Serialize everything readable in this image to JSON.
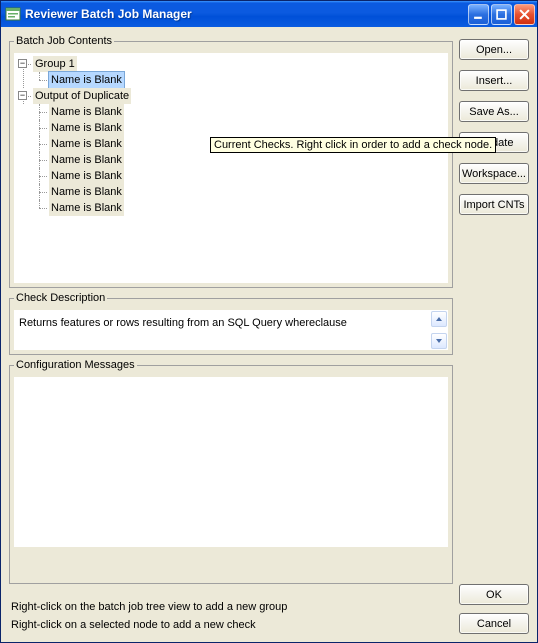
{
  "window": {
    "title": "Reviewer Batch Job Manager"
  },
  "tooltip": "Current Checks. Right click in order to add a check node.",
  "sections": {
    "contents": "Batch Job Contents",
    "description": "Check Description",
    "config": "Configuration Messages"
  },
  "tree": {
    "group1": "Group 1",
    "group1_children": [
      "Name is Blank"
    ],
    "output": "Output of Duplicate",
    "output_children": [
      "Name is Blank",
      "Name is Blank",
      "Name is Blank",
      "Name is Blank",
      "Name is Blank",
      "Name is Blank",
      "Name is Blank"
    ]
  },
  "description_text": "Returns features or rows resulting from an SQL Query whereclause",
  "buttons": {
    "open": "Open...",
    "insert": "Insert...",
    "saveas": "Save As...",
    "validate": "Validate",
    "workspace": "Workspace...",
    "importcnts": "Import CNTs",
    "ok": "OK",
    "cancel": "Cancel"
  },
  "hints": {
    "h1": "Right-click on the batch job tree view to add a new group",
    "h2": "Right-click on a selected node to add a new check"
  }
}
